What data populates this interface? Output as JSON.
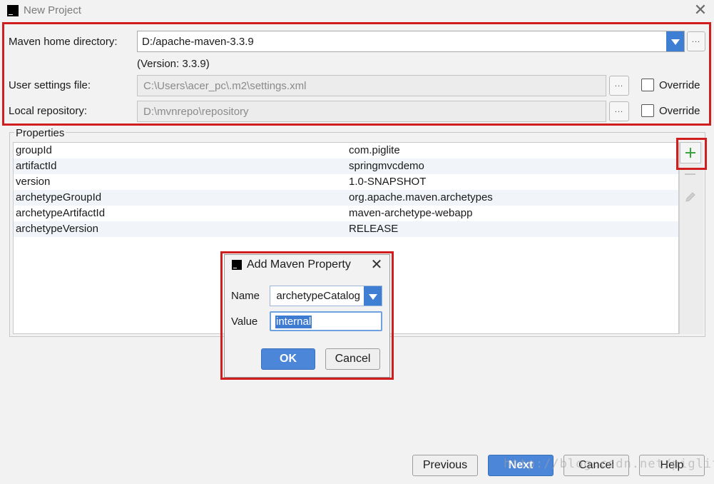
{
  "window": {
    "title": "New Project"
  },
  "maven": {
    "home_label": "Maven home directory:",
    "home_value": "D:/apache-maven-3.3.9",
    "version_text": "(Version: 3.3.9)",
    "settings_label": "User settings file:",
    "settings_value": "C:\\Users\\acer_pc\\.m2\\settings.xml",
    "repo_label": "Local repository:",
    "repo_value": "D:\\mvnrepo\\repository",
    "override_label": "Override",
    "browse_label": "..."
  },
  "properties": {
    "legend": "Properties",
    "rows": [
      {
        "key": "groupId",
        "value": "com.piglite"
      },
      {
        "key": "artifactId",
        "value": "springmvcdemo"
      },
      {
        "key": "version",
        "value": "1.0-SNAPSHOT"
      },
      {
        "key": "archetypeGroupId",
        "value": "org.apache.maven.archetypes"
      },
      {
        "key": "archetypeArtifactId",
        "value": "maven-archetype-webapp"
      },
      {
        "key": "archetypeVersion",
        "value": "RELEASE"
      }
    ]
  },
  "dialog": {
    "title": "Add Maven Property",
    "name_label": "Name",
    "name_value": "archetypeCatalog",
    "value_label": "Value",
    "value_value": "internal",
    "ok_label": "OK",
    "cancel_label": "Cancel"
  },
  "footer": {
    "previous_label": "Previous",
    "next_label": "Next",
    "cancel_label": "Cancel",
    "help_label": "Help"
  },
  "watermark": "http://blog.csdn.net/piglite",
  "colors": {
    "accent": "#4b86d9",
    "highlight_border": "#d01e1e",
    "add_icon": "#3aa23a"
  }
}
